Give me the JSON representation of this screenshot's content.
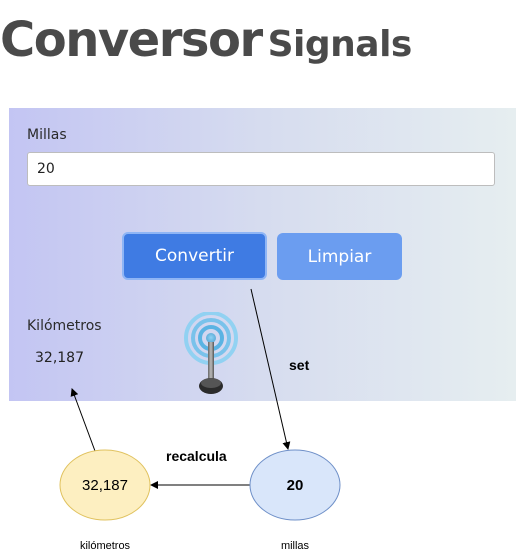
{
  "header": {
    "title_main": "Conversor",
    "title_sub": "Signals"
  },
  "form": {
    "miles_label": "Millas",
    "miles_value": "20",
    "convert_label": "Convertir",
    "clear_label": "Limpiar",
    "km_label": "Kilómetros",
    "km_value": "32,187"
  },
  "diagram": {
    "set_label": "set",
    "recalc_label": "recalcula",
    "km_node_value": "32,187",
    "km_node_caption": "kilómetros",
    "miles_node_value": "20",
    "miles_node_caption": "millas"
  },
  "icons": {
    "signal": "antenna-signal-icon"
  },
  "colors": {
    "primary_button": "#3f7be3",
    "secondary_button": "#6b9df0",
    "km_node_fill": "#fdefc1",
    "miles_node_fill": "#d9e6fa"
  }
}
